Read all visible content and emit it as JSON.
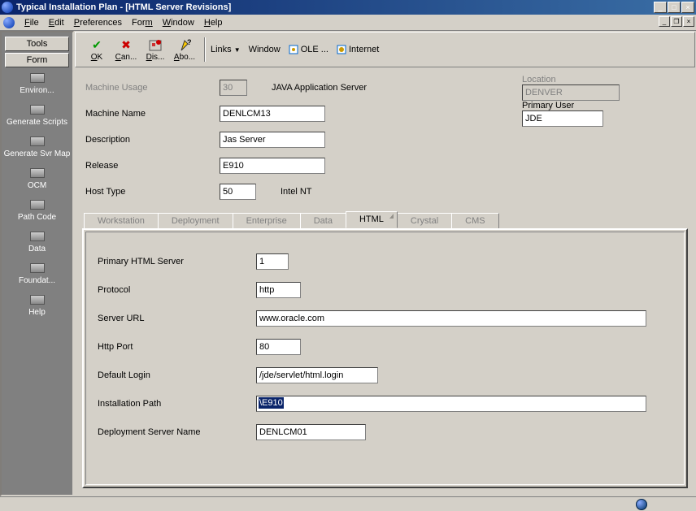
{
  "window": {
    "title": "Typical Installation Plan - [HTML Server Revisions]"
  },
  "menu": {
    "file": "File",
    "edit": "Edit",
    "preferences": "Preferences",
    "form": "Form",
    "window": "Window",
    "help": "Help"
  },
  "sidebar": {
    "tools_btn": "Tools",
    "form_btn": "Form",
    "items": [
      "Environ...",
      "Generate Scripts",
      "Generate Svr Map",
      "OCM",
      "Path Code",
      "Data",
      "Foundat...",
      "Help"
    ]
  },
  "toolbar": {
    "ok": "OK",
    "cancel": "Can...",
    "display": "Dis...",
    "about": "Abo...",
    "links_label": "Links",
    "window": "Window",
    "ole": "OLE ...",
    "internet": "Internet"
  },
  "form": {
    "machine_usage_lbl": "Machine Usage",
    "machine_usage_val": "30",
    "machine_usage_desc": "JAVA Application Server",
    "location_lbl": "Location",
    "location_val": "DENVER",
    "machine_name_lbl": "Machine Name",
    "machine_name_val": "DENLCM13",
    "primary_user_lbl": "Primary User",
    "primary_user_val": "JDE",
    "description_lbl": "Description",
    "description_val": "Jas Server",
    "release_lbl": "Release",
    "release_val": "E910",
    "host_type_lbl": "Host Type",
    "host_type_val": "50",
    "host_type_desc": "Intel NT"
  },
  "tabs": {
    "workstation": "Workstation",
    "deployment": "Deployment",
    "enterprise": "Enterprise",
    "data": "Data",
    "html": "HTML",
    "crystal": "Crystal",
    "cms": "CMS"
  },
  "html_tab": {
    "primary_html_lbl": "Primary HTML Server",
    "primary_html_val": "1",
    "protocol_lbl": "Protocol",
    "protocol_val": "http",
    "server_url_lbl": "Server URL",
    "server_url_val": "www.oracle.com",
    "http_port_lbl": "Http Port",
    "http_port_val": "80",
    "default_login_lbl": "Default Login",
    "default_login_val": "/jde/servlet/html.login",
    "install_path_lbl": "Installation Path",
    "install_path_val": "\\E910",
    "dep_server_lbl": "Deployment Server Name",
    "dep_server_val": "DENLCM01"
  }
}
